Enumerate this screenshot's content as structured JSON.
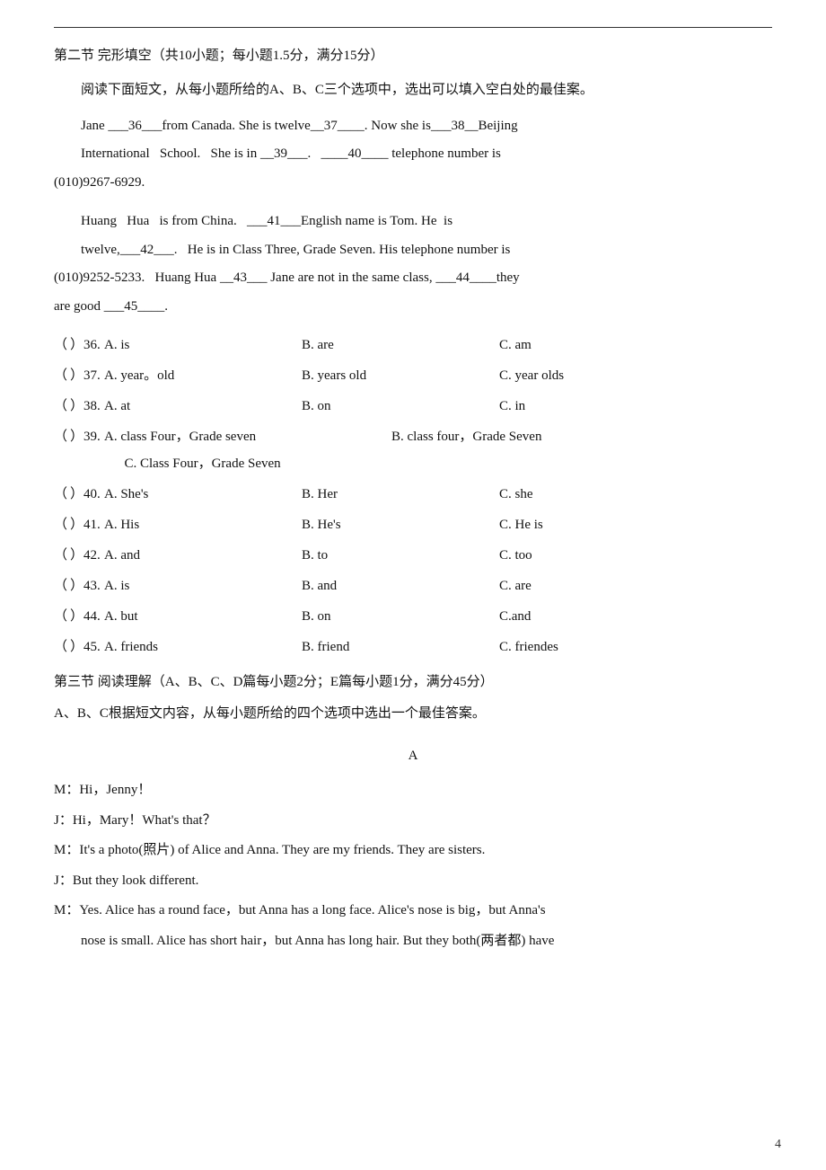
{
  "page": {
    "topline": true,
    "section2": {
      "title": "第二节  完形填空（共10小题；每小题1.5分，满分15分）",
      "instruction": "阅读下面短文，从每小题所给的A、B、C三个选项中，选出可以填入空白处的最佳案。",
      "passage1": "Jane ___36___from  Canada.  She  is  twelve__37____.  Now  she  is___38__Beijing",
      "passage1b": "International   School.   She  is  in  __39___.   ____40____  telephone  number  is",
      "passage1c": "(010)9267-6929.",
      "passage2": "Huang   Hua   is  from  China.   ___41___English  name  is  Tom.  He  is",
      "passage2b": "twelve,___42___.  He  is  in  Class  Three,  Grade  Seven.  His  telephone  number  is",
      "passage2c": "(010)9252-5233.   Huang  Hua  __43___  Jane  are  not  in  the  same  class,  ___44____they",
      "passage2d": "are  good  ___45____.",
      "questions": [
        {
          "paren": "（",
          "rparen": "）",
          "num": "36.",
          "options": [
            "A. is",
            "B. are",
            "C. am"
          ]
        },
        {
          "paren": "（",
          "rparen": "）",
          "num": "37.",
          "options": [
            "A. year。old",
            "B. years  old",
            "C. year  olds"
          ]
        },
        {
          "paren": "（",
          "rparen": "）",
          "num": "38.",
          "options": [
            "A. at",
            "B. on",
            "C. in"
          ]
        },
        {
          "paren": "（",
          "rparen": "）",
          "num": "39.",
          "options": [
            "A. class Four，Grade seven",
            "B. class four，Grade  Seven",
            "C. Class Four，Grade Seven"
          ]
        },
        {
          "paren": "（",
          "rparen": "）",
          "num": "40.",
          "options": [
            "A. She's",
            "B. Her",
            "C. she"
          ]
        },
        {
          "paren": "（",
          "rparen": "）",
          "num": "41.",
          "options": [
            "A. His",
            "B. He's",
            "C. He  is"
          ]
        },
        {
          "paren": "（",
          "rparen": "）",
          "num": "42.",
          "options": [
            "A. and",
            "B. to",
            "C. too"
          ]
        },
        {
          "paren": "（",
          "rparen": "）",
          "num": "43.",
          "options": [
            "A. is",
            "B. and",
            "C. are"
          ]
        },
        {
          "paren": "（",
          "rparen": "）",
          "num": "44.",
          "options": [
            "A. but",
            "B. on",
            "C.and"
          ]
        },
        {
          "paren": "（",
          "rparen": "）",
          "num": "45.",
          "options": [
            "A. friends",
            "B. friend",
            "C. friendes"
          ]
        }
      ]
    },
    "section3": {
      "title": "第三节  阅读理解（A、B、C、D篇每小题2分；E篇每小题1分，满分45分）",
      "instruction": "A、B、C根据短文内容，从每小题所给的四个选项中选出一个最佳答案。",
      "center_label": "A",
      "dialogue": [
        "M：Hi，Jenny！",
        "J：Hi，Mary！What's that？",
        "M：It's a photo(照片) of Alice and Anna. They are my friends. They are sisters.",
        "J：But they look different.",
        "M：Yes. Alice has a round face，but Anna has a long face. Alice's nose is big，but Anna's",
        "   nose is small. Alice has short hair，but Anna has long hair. But they both(两者都) have"
      ]
    },
    "page_number": "4"
  }
}
